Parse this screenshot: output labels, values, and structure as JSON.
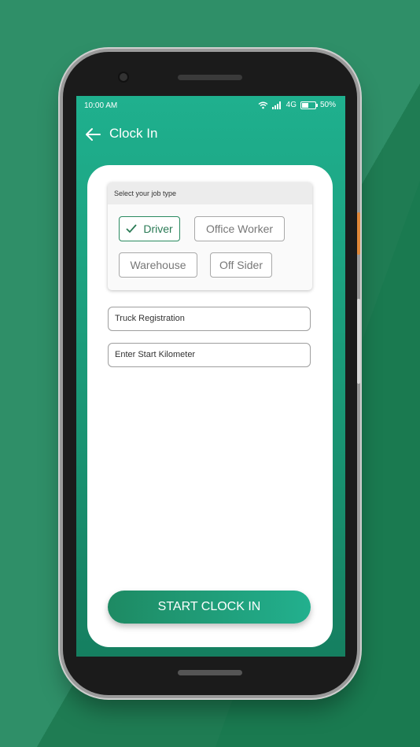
{
  "status_bar": {
    "time": "10:00 AM",
    "network": "4G",
    "battery_percent": "50%",
    "battery_level": 0.5
  },
  "app_bar": {
    "title": "Clock In",
    "back_icon": "arrow-left-icon"
  },
  "job_type": {
    "header": "Select your job type",
    "options": [
      {
        "label": "Driver",
        "selected": true
      },
      {
        "label": "Office Worker",
        "selected": false
      },
      {
        "label": "Warehouse",
        "selected": false
      },
      {
        "label": "Off Sider",
        "selected": false
      }
    ]
  },
  "form": {
    "truck_registration_placeholder": "Truck Registration",
    "start_km_placeholder": "Enter Start Kilometer"
  },
  "cta": {
    "label": "START CLOCK IN"
  },
  "colors": {
    "brand_green": "#1fb08e",
    "dark_green": "#1a7a50",
    "selected_green": "#2a8a60"
  }
}
